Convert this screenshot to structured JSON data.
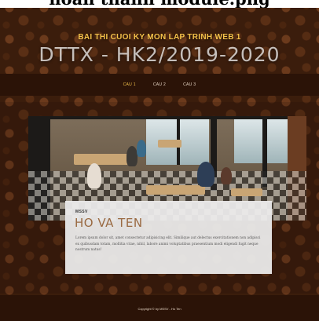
{
  "caption": {
    "text": "hoàn thành module.png"
  },
  "header": {
    "sub_title": "BAI THI CUOI KY MON LAP TRINH WEB 1",
    "main_title": "DTTX - HK2/2019-2020"
  },
  "nav": {
    "items": [
      "CAU 1",
      "CAU 2",
      "CAU 3"
    ]
  },
  "card": {
    "kicker": "MSSV",
    "name": "HO VA TEN",
    "body": "Lorem ipsum dolor sit, amet consectetur adipisicing elit. Similique aut delectus exercitationem non adipisci ex quibusdam totam, mollitia vitae, nihil, labore animi voluptatibus praesentium modi eligendi fugit neque nostrum natus!"
  },
  "footer": {
    "text": "Copyright © by MSSV - Ho Ten"
  },
  "colors": {
    "accent": "#f5c24a",
    "dark_bar": "#2b1307",
    "name": "#9a6a42"
  }
}
